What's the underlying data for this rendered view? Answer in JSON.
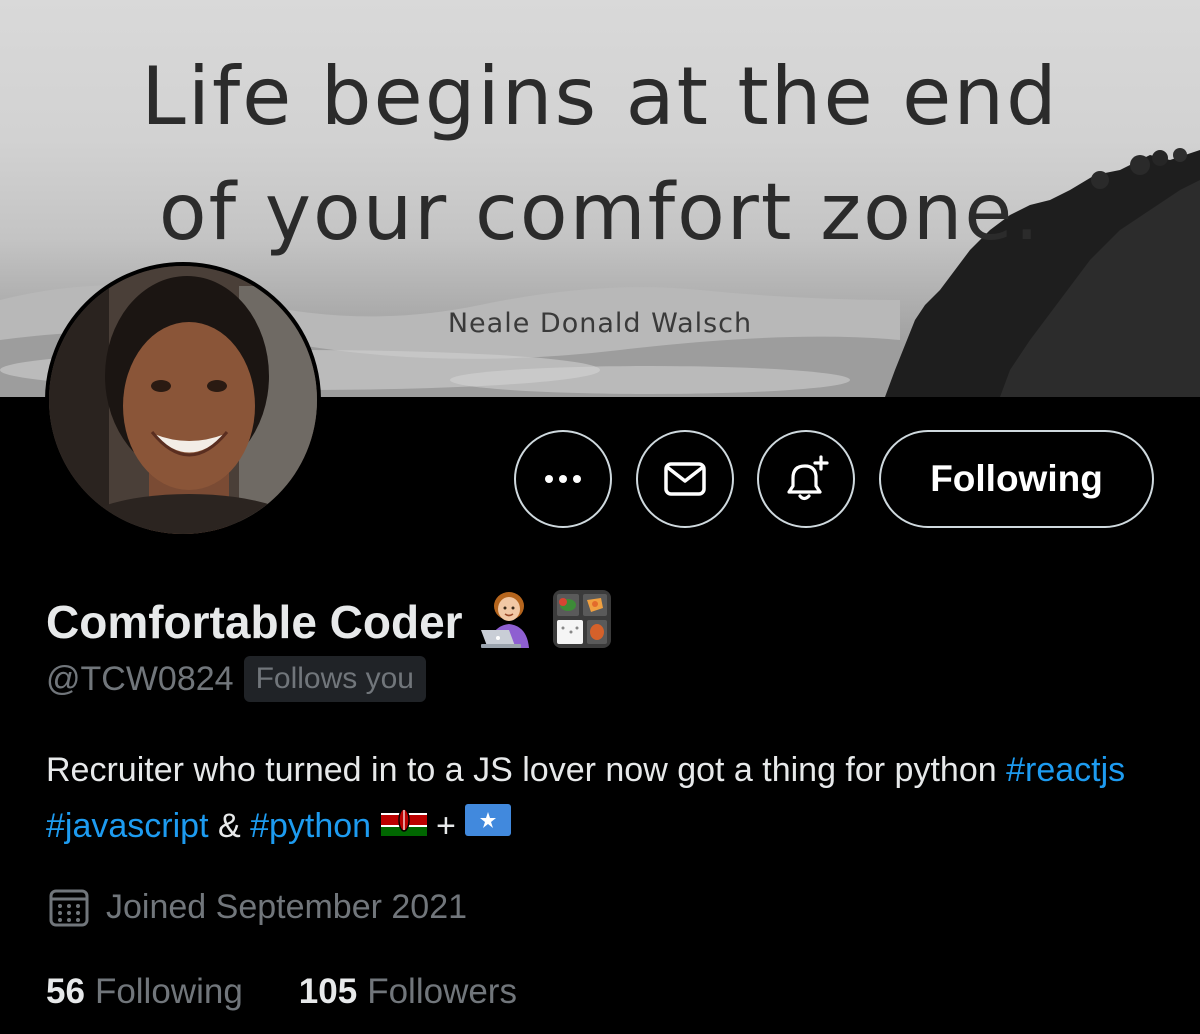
{
  "banner": {
    "quote_line_1": "Life begins at the end",
    "quote_line_2": "of your comfort zone.",
    "quote_author": "Neale Donald Walsch"
  },
  "actions": {
    "more_icon": "more-horizontal-icon",
    "message_icon": "envelope-icon",
    "notify_icon": "bell-plus-icon",
    "follow_label": "Following"
  },
  "profile": {
    "display_name": "Comfortable Coder",
    "name_emojis": [
      "woman-technologist-icon",
      "bento-box-icon"
    ],
    "handle": "@TCW0824",
    "follows_you": "Follows you",
    "bio": {
      "text_1": "Recruiter who turned in to a JS lover now got a thing for python ",
      "tag_1": "#reactjs",
      "space_1": " ",
      "tag_2": "#javascript",
      "text_2": " & ",
      "tag_3": "#python",
      "flag_1": "kenya-flag-icon",
      "plus": " + ",
      "flag_2": "somalia-flag-icon"
    },
    "joined_icon": "calendar-icon",
    "joined": "Joined September 2021"
  },
  "stats": {
    "following_count": "56",
    "following_label": "Following",
    "followers_count": "105",
    "followers_label": "Followers"
  },
  "colors": {
    "background": "#000000",
    "text_primary": "#e7e9ea",
    "text_secondary": "#71767b",
    "link": "#1d9bf0",
    "badge_bg": "#202327"
  }
}
